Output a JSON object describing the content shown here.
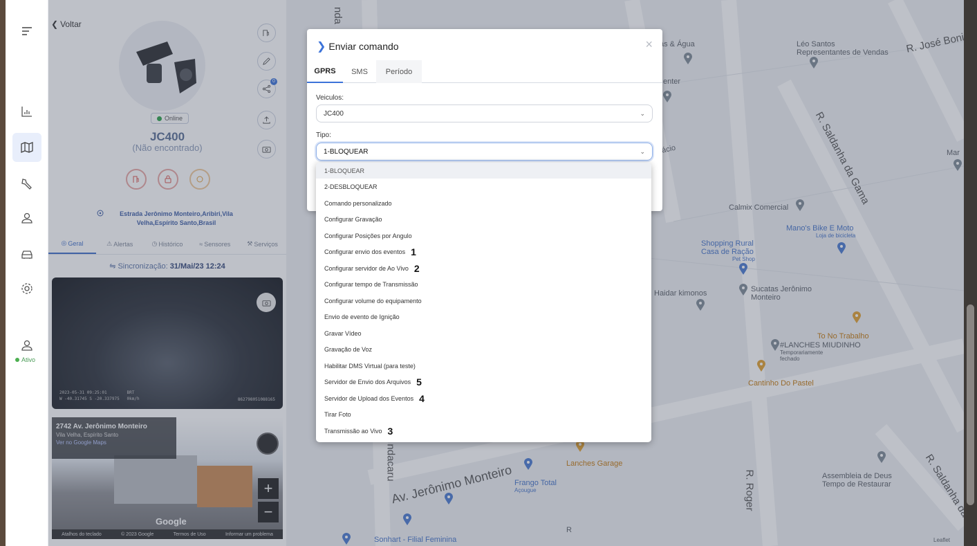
{
  "rail": {
    "status_label": "Ativo"
  },
  "vehicle": {
    "back_label": "Voltar",
    "online_label": "Online",
    "name": "JC400",
    "location_status": "(Não encontrado)",
    "address_line1": "Estrada Jerônimo Monteiro,Aribiri,Vila",
    "address_line2": "Velha,Espírito Santo,Brasil",
    "tabs": [
      "Geral",
      "Alertas",
      "Histórico",
      "Sensores",
      "Serviços"
    ],
    "sync_label": "Sincronização:",
    "sync_value": "31/Mai/23 12:24",
    "notification_count": "0",
    "video_timestamp": "2023-05-31 09:25:01",
    "video_timezone": "BRT",
    "video_coords": "W -40.31745 S -20.337975",
    "video_speed": "0km/h",
    "video_device_id": "862798051088165"
  },
  "streetview": {
    "title": "2742 Av. Jerônimo Monteiro",
    "subtitle": "Vila Velha, Espírito Santo",
    "link": "Ver no Google Maps",
    "brand": "Google",
    "footer": [
      "Atalhos do teclado",
      "© 2023 Google",
      "Termos de Uso",
      "Informar um problema"
    ]
  },
  "map": {
    "labels": {
      "agua": "ás & Água",
      "leo1": "Léo Santos",
      "leo2": "Representantes de Vendas",
      "jose": "R. José Boni",
      "enter": "enter",
      "facio": "fácio",
      "saldanha": "R. Saldanha da Gama",
      "mar": "Mar",
      "calmix": "Calmix Comercial",
      "manos": "Mano's Bike E Moto",
      "manos_sub": "Loja de bicicleta",
      "shopping1": "Shopping Rural",
      "shopping2": "Casa de Ração",
      "petshop": "Pet Shop",
      "haidar": "Haidar kimonos",
      "sucatas1": "Sucatas Jerônimo",
      "sucatas2": "Monteiro",
      "tono": "To No Trabalho",
      "lanches1": "#LANCHES MIUDINHO",
      "lanches2": "Temporariamente",
      "lanches3": "fechado",
      "cantinho": "Cantinho Do Pastel",
      "ndacaru": "ndacaru",
      "ndacaru_top": "nda",
      "avjm": "Av. Jerônimo Monteiro",
      "garage": "Lanches Garage",
      "frango": "Frango Total",
      "acougue": "Açougue",
      "roger": "R. Roger",
      "assembleia1": "Assembleia de Deus",
      "assembleia2": "Tempo de Restaurar",
      "saldanha2": "R. Saldanha da G",
      "sonhart": "Sonhart - Filial Feminina",
      "leaflet": "Leaflet",
      "r_short": "R"
    }
  },
  "modal": {
    "title": "Enviar comando",
    "close": "×",
    "tabs": [
      "GPRS",
      "SMS",
      "Período"
    ],
    "vehicles_label": "Veiculos:",
    "vehicles_value": "JC400",
    "type_label": "Tipo:",
    "type_value": "1-BLOQUEAR",
    "options": [
      {
        "label": "1-BLOQUEAR",
        "num": ""
      },
      {
        "label": "2-DESBLOQUEAR",
        "num": ""
      },
      {
        "label": "Comando personalizado",
        "num": ""
      },
      {
        "label": "Configurar Gravação",
        "num": ""
      },
      {
        "label": "Configurar Posições por Angulo",
        "num": ""
      },
      {
        "label": "Configurar envio dos eventos",
        "num": "1"
      },
      {
        "label": "Configurar servidor de Ao Vivo",
        "num": "2"
      },
      {
        "label": "Configurar tempo de Transmissão",
        "num": ""
      },
      {
        "label": "Configurar volume do equipamento",
        "num": ""
      },
      {
        "label": "Envio de evento de Ignição",
        "num": ""
      },
      {
        "label": "Gravar Vídeo",
        "num": ""
      },
      {
        "label": "Gravação de Voz",
        "num": ""
      },
      {
        "label": "Habilitar DMS Virtual (para teste)",
        "num": ""
      },
      {
        "label": "Servidor de Envio dos Arquivos",
        "num": "5"
      },
      {
        "label": "Servidor de Upload dos Eventos",
        "num": "4"
      },
      {
        "label": "Tirar Foto",
        "num": ""
      },
      {
        "label": "Transmissão ao Vivo",
        "num": "3"
      }
    ]
  },
  "colors": {
    "accent": "#3c73d9",
    "online": "#2da24b",
    "overlay": "#464e60"
  }
}
